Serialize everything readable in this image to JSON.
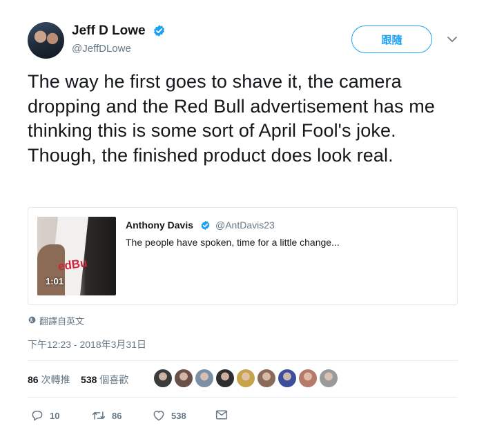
{
  "author": {
    "name": "Jeff D Lowe",
    "handle": "@JeffDLowe",
    "verified": true
  },
  "follow_button": {
    "label": "跟隨"
  },
  "tweet_text": "The way he first goes to shave it, the camera dropping and the Red Bull advertisement has me thinking this is some sort of April Fool's joke. Though, the finished product does look real.",
  "quoted_tweet": {
    "name": "Anthony Davis",
    "handle": "@AntDavis23",
    "verified": true,
    "text": "The people have spoken, time for a little change...",
    "thumbnail_text": "edBu",
    "video_duration": "1:01"
  },
  "translate_label": "翻譯自英文",
  "timestamp": "下午12:23 - 2018年3月31日",
  "stats": {
    "retweets_count": "86",
    "retweets_label": "次轉推",
    "likes_count": "538",
    "likes_label": "個喜歡"
  },
  "liker_avatar_colors": [
    "#3b3b3b",
    "#6b4f4a",
    "#7b8fa6",
    "#2e2e2e",
    "#c7a34b",
    "#8a6a58",
    "#3d4f9b",
    "#b57a6a",
    "#9a9a9a"
  ],
  "actions": {
    "reply_count": "10",
    "retweet_count": "86",
    "like_count": "538"
  },
  "colors": {
    "accent": "#1da1f2",
    "secondary_text": "#657786"
  }
}
